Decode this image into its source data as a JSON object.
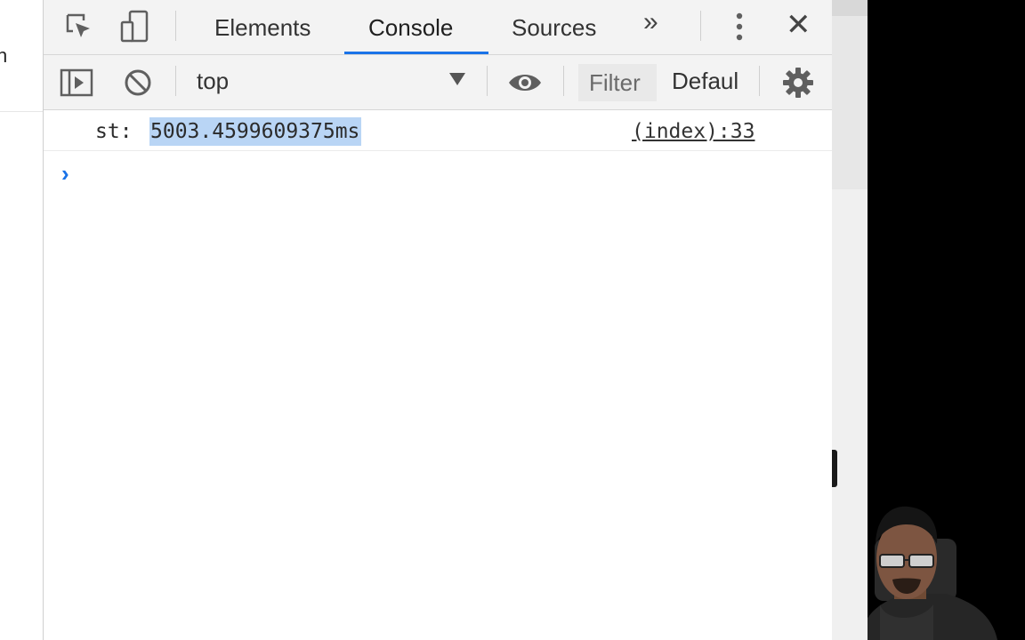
{
  "page_sliver": {
    "visible_char": "n"
  },
  "devtools": {
    "tabs": [
      {
        "label": "Elements",
        "active": false
      },
      {
        "label": "Console",
        "active": true
      },
      {
        "label": "Sources",
        "active": false
      }
    ],
    "more_tabs_glyph": "»",
    "close_glyph": "✕",
    "toolbar": {
      "context": "top",
      "filter_placeholder": "Filter",
      "levels_label": "Defaul"
    },
    "console": {
      "entries": [
        {
          "prefix": "st: ",
          "value": "5003.4599609375ms",
          "source": "(index):33"
        }
      ],
      "prompt_glyph": "›"
    }
  },
  "colors": {
    "accent": "#1a73e8",
    "selection": "#b9d5f5",
    "toolbar_bg": "#f3f3f3",
    "webcam_bg": "#000000"
  },
  "icons": [
    "inspect-element-icon",
    "device-toolbar-icon",
    "more-tabs-icon",
    "kebab-menu-icon",
    "close-icon",
    "sidebar-toggle-icon",
    "clear-console-icon",
    "dropdown-arrow-icon",
    "eye-icon",
    "gear-icon",
    "prompt-chevron-icon"
  ]
}
